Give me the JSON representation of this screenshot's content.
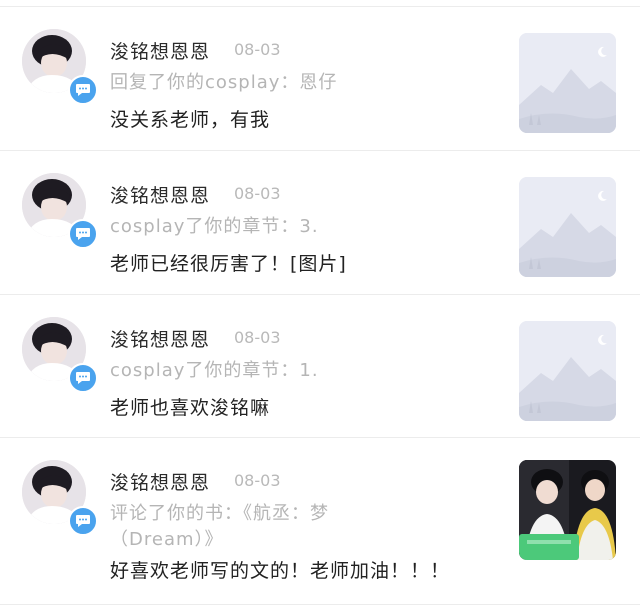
{
  "notifications": [
    {
      "name": "浚铭想恩恩",
      "time": "08-03",
      "reference": "回复了你的cosplay：恩仔",
      "message": "没关系老师，有我",
      "thumbnail": "placeholder-image-icon"
    },
    {
      "name": "浚铭想恩恩",
      "time": "08-03",
      "reference": "cosplay了你的章节：3.",
      "message": "老师已经很厉害了！[图片]",
      "thumbnail": "placeholder-image-icon"
    },
    {
      "name": "浚铭想恩恩",
      "time": "08-03",
      "reference": "cosplay了你的章节：1.",
      "message": "老师也喜欢浚铭嘛",
      "thumbnail": "placeholder-image-icon"
    },
    {
      "name": "浚铭想恩恩",
      "time": "08-03",
      "reference": "评论了你的书：《航丞：梦（Dream）》",
      "message": "好喜欢老师写的文的！老师加油！！！",
      "thumbnail": "book-cover-photo"
    }
  ],
  "colors": {
    "badge": "#4aa3ee",
    "name_text": "#2b2b2b",
    "muted_text": "#b5b5b5",
    "message_text": "#222222",
    "divider": "#ececec"
  },
  "icons": {
    "badge": "chat-bubble-icon"
  }
}
